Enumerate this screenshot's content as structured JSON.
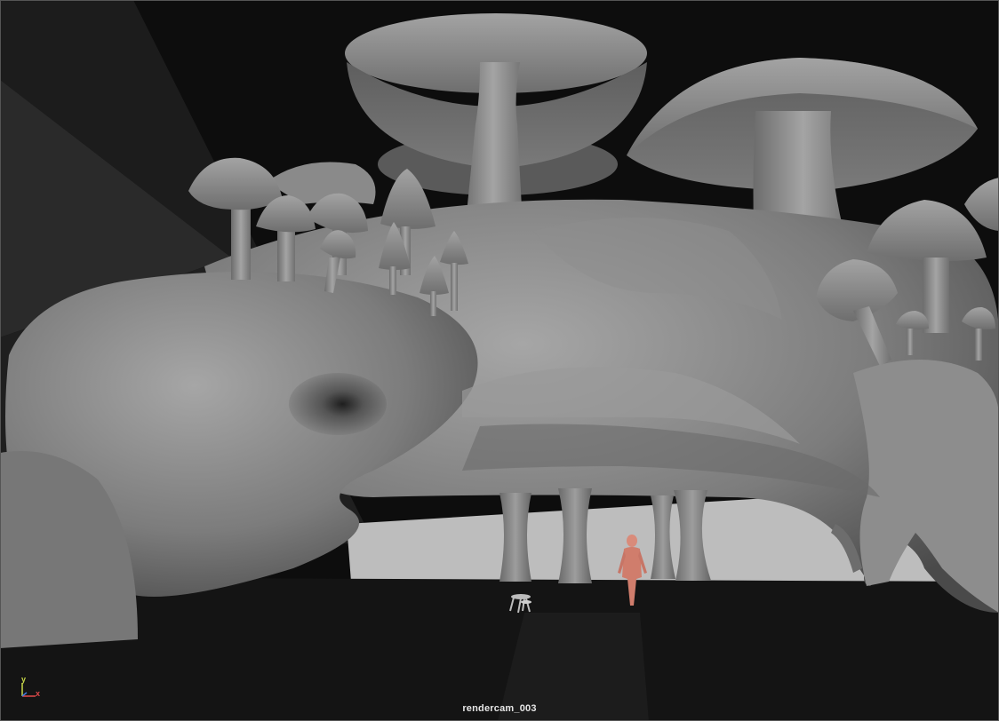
{
  "viewport": {
    "camera_name": "rendercam_003",
    "axis": {
      "y_label": "y",
      "x_label": "x"
    }
  },
  "colors": {
    "background": "#0b0b0b",
    "model_gray": "#8a8a8a",
    "human_figure": "#d98b7a",
    "axis_y": "#c9d84a",
    "axis_x": "#e24a4a"
  }
}
